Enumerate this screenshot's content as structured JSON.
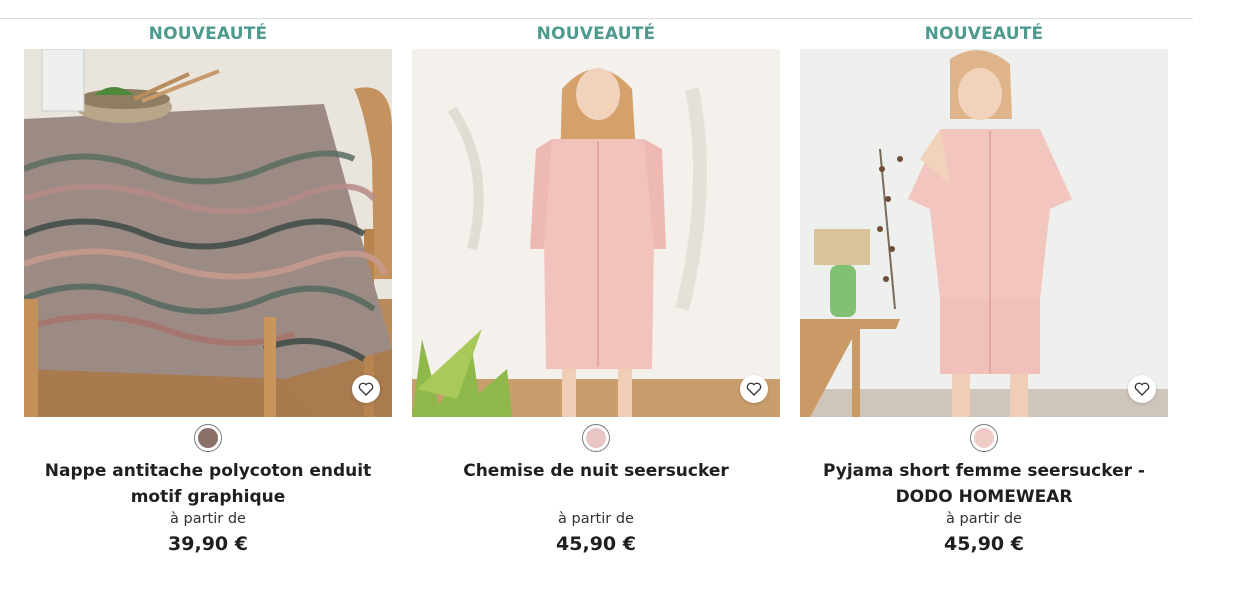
{
  "products": [
    {
      "badge": "NOUVEAUTÉ",
      "title": "Nappe antitache polycoton enduit motif graphique",
      "from_label": "à partir de",
      "price": "39,90 €",
      "swatch_color": "#8a6f66",
      "photo_icon": "tablecloth-photo"
    },
    {
      "badge": "NOUVEAUTÉ",
      "title": "Chemise de nuit seersucker",
      "from_label": "à partir de",
      "price": "45,90 €",
      "swatch_color": "#e8c6c3",
      "photo_icon": "nightshirt-photo"
    },
    {
      "badge": "NOUVEAUTÉ",
      "title": "Pyjama short femme seersucker - DODO HOMEWEAR",
      "from_label": "à partir de",
      "price": "45,90 €",
      "swatch_color": "#efcbc6",
      "photo_icon": "pyjama-photo"
    }
  ],
  "colors": {
    "badge_text": "#4e9a8f",
    "fav_background": "#ffffff"
  }
}
